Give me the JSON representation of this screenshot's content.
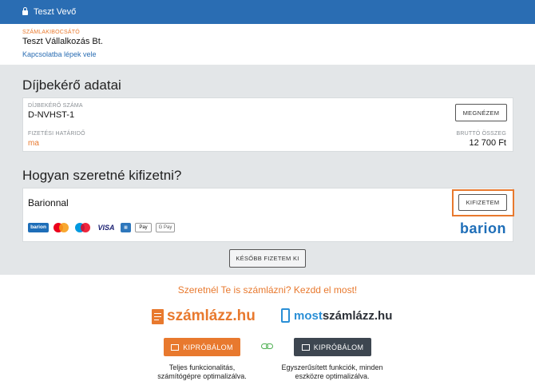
{
  "topbar": {
    "user": "Teszt Vevő"
  },
  "issuer": {
    "label": "SZÁMLAKIBOCSÁTÓ",
    "name": "Teszt Vállalkozás Bt.",
    "contact_link": "Kapcsolatba lépek vele"
  },
  "invoice": {
    "section_title": "Díjbekérő adatai",
    "number_label": "DÍJBEKÉRŐ SZÁMA",
    "number_value": "D-NVHST-1",
    "view_button": "MEGNÉZEM",
    "due_label": "FIZETÉSI HATÁRIDŐ",
    "due_value": "ma",
    "gross_label": "BRUTTÓ ÖSSZEG",
    "gross_value": "12 700 Ft"
  },
  "payment": {
    "section_title": "Hogyan szeretné kifizetni?",
    "method_name": "Barionnal",
    "pay_button": "KIFIZETEM",
    "card_logos": [
      "barion",
      "mastercard",
      "maestro",
      "VISA",
      "amex",
      "Apple Pay",
      "G Pay"
    ],
    "provider_logo": "barion",
    "later_button": "KÉSŐBB FIZETEM KI"
  },
  "promo": {
    "title": "Szeretnél Te is számlázni? Kezdd el most!",
    "left_brand": "számlázz.hu",
    "right_brand_prefix": "most",
    "right_brand_suffix": "számlázz.hu",
    "left_button": "KIPRÓBÁLOM",
    "right_button": "KIPRÓBÁLOM",
    "left_desc_1": "Teljes funkcionalitás,",
    "left_desc_2": "számítógépre optimalizálva.",
    "right_desc_1": "Egyszerűsített funkciók, minden",
    "right_desc_2": "eszközre optimalizálva."
  },
  "colors": {
    "topbar": "#2a6db3",
    "accent_orange": "#e8792e",
    "dark_button": "#3d4650",
    "highlight_border": "#e8792e",
    "barion_blue": "#1e6eb8"
  }
}
